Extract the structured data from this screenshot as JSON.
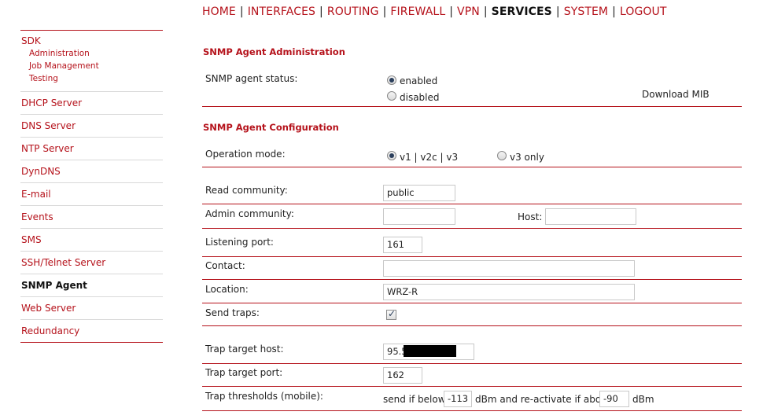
{
  "nav": {
    "items": [
      "HOME",
      "INTERFACES",
      "ROUTING",
      "FIREWALL",
      "VPN",
      "SERVICES",
      "SYSTEM",
      "LOGOUT"
    ],
    "active": "SERVICES",
    "separator": "|"
  },
  "sidebar": {
    "sdk": {
      "label": "SDK",
      "subitems": [
        "Administration",
        "Job Management",
        "Testing"
      ]
    },
    "items": [
      "DHCP Server",
      "DNS Server",
      "NTP Server",
      "DynDNS",
      "E-mail",
      "Events",
      "SMS",
      "SSH/Telnet Server",
      "SNMP Agent",
      "Web Server",
      "Redundancy"
    ],
    "active": "SNMP Agent"
  },
  "admin": {
    "title": "SNMP Agent Administration",
    "status_label": "SNMP agent status:",
    "enabled_label": "enabled",
    "disabled_label": "disabled",
    "selected": "enabled",
    "download_link": "Download MIB"
  },
  "config": {
    "title": "SNMP Agent Configuration",
    "operation_mode_label": "Operation mode:",
    "mode_v1v2v3": "v1 | v2c | v3",
    "mode_v3only": "v3 only",
    "mode_selected": "v1 | v2c | v3",
    "read_community_label": "Read community:",
    "read_community_value": "public",
    "admin_community_label": "Admin community:",
    "admin_community_value": "",
    "host_label": "Host:",
    "host_value": "",
    "listening_port_label": "Listening port:",
    "listening_port_value": "161",
    "contact_label": "Contact:",
    "contact_value": "",
    "location_label": "Location:",
    "location_value": "WRZ-R",
    "send_traps_label": "Send traps:",
    "send_traps_checked": true,
    "trap_target_host_label": "Trap target host:",
    "trap_target_host_value": "95.5",
    "trap_target_port_label": "Trap target port:",
    "trap_target_port_value": "162",
    "trap_thresholds_label": "Trap thresholds (mobile):",
    "send_if_below_text": "send if below",
    "threshold_below_value": "-113",
    "reactivate_text": "dBm and re-activate if above",
    "threshold_above_value": "-90",
    "dbm_text": "dBm"
  },
  "colors": {
    "accent": "#b5121b",
    "text": "#222222"
  }
}
